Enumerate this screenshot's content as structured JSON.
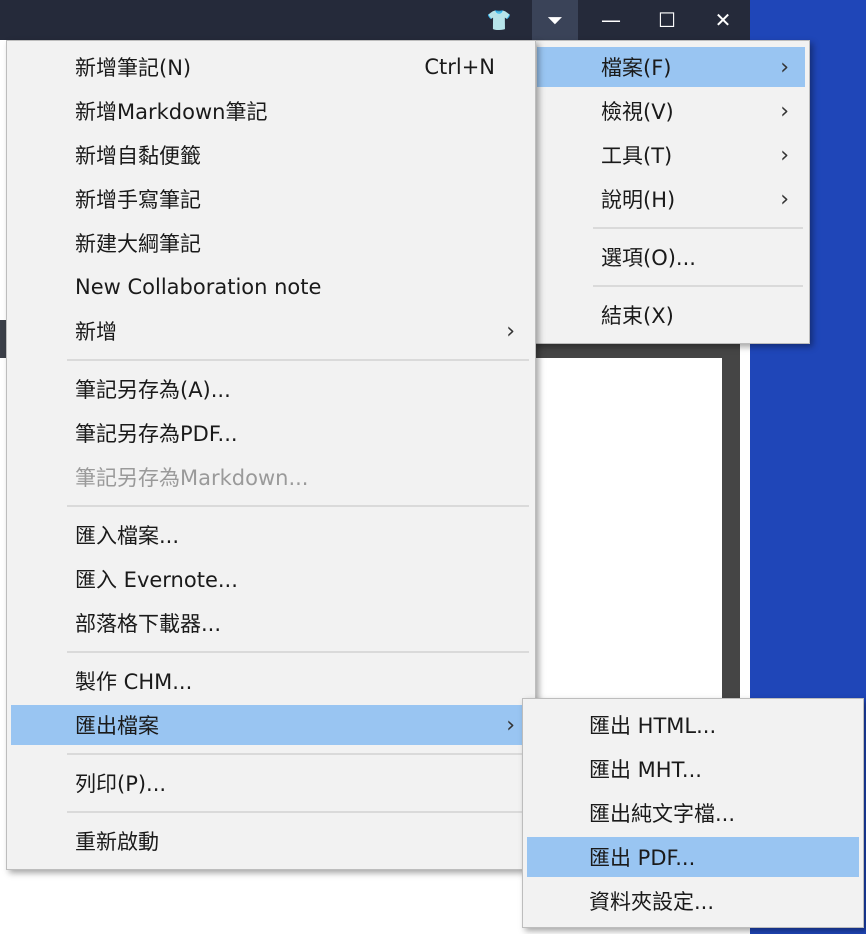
{
  "colors": {
    "menu_bg": "#f2f2f2",
    "highlight": "#99c5f2",
    "titlebar": "#252a3a",
    "desktop": "#1f46b8",
    "disabled_text": "#9a9a9a"
  },
  "titlebar": {
    "buttons": [
      {
        "name": "skin-icon",
        "glyph": "👕"
      },
      {
        "name": "menu-dropdown-icon",
        "glyph": "⏷"
      },
      {
        "name": "minimize-icon",
        "glyph": "—"
      },
      {
        "name": "maximize-icon",
        "glyph": "☐"
      },
      {
        "name": "close-icon",
        "glyph": "✕"
      }
    ]
  },
  "main_menu": {
    "items": [
      {
        "label": "檔案(F)",
        "arrow": "›",
        "highlighted": true
      },
      {
        "label": "檢視(V)",
        "arrow": "›"
      },
      {
        "label": "工具(T)",
        "arrow": "›"
      },
      {
        "label": "說明(H)",
        "arrow": "›"
      },
      {
        "label": "選項(O)..."
      },
      {
        "label": "結束(X)"
      }
    ]
  },
  "file_menu": {
    "items": [
      {
        "label": "新增筆記(N)",
        "shortcut": "Ctrl+N"
      },
      {
        "label": "新增Markdown筆記"
      },
      {
        "label": "新增自黏便籤"
      },
      {
        "label": "新增手寫筆記"
      },
      {
        "label": "新建大綱筆記"
      },
      {
        "label": "New Collaboration note"
      },
      {
        "label": "新增",
        "arrow": "›"
      },
      {
        "label": "筆記另存為(A)..."
      },
      {
        "label": "筆記另存為PDF..."
      },
      {
        "label": "筆記另存為Markdown...",
        "disabled": true
      },
      {
        "label": "匯入檔案..."
      },
      {
        "label": "匯入 Evernote..."
      },
      {
        "label": "部落格下載器..."
      },
      {
        "label": "製作 CHM..."
      },
      {
        "label": "匯出檔案",
        "arrow": "›",
        "highlighted": true
      },
      {
        "label": "列印(P)..."
      },
      {
        "label": "重新啟動"
      }
    ]
  },
  "export_menu": {
    "items": [
      {
        "label": "匯出 HTML..."
      },
      {
        "label": "匯出 MHT..."
      },
      {
        "label": "匯出純文字檔..."
      },
      {
        "label": "匯出 PDF...",
        "highlighted": true
      },
      {
        "label": "資料夾設定..."
      }
    ]
  }
}
